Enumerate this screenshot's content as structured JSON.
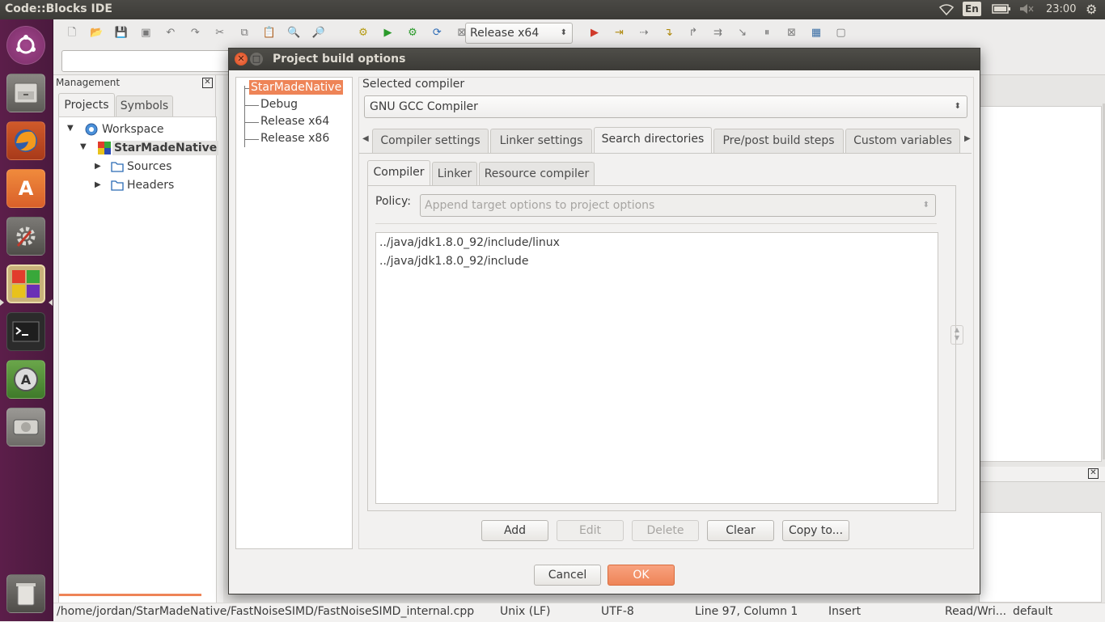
{
  "top_panel": {
    "window_title": "Code::Blocks IDE",
    "keyboard": "En",
    "time": "23:00"
  },
  "launcher": {
    "items": [
      "ubuntu-logo-icon",
      "file-manager-icon",
      "firefox-icon",
      "software-center-icon",
      "system-settings-icon",
      "codeblocks-icon",
      "terminal-icon",
      "software-updater-icon",
      "disk-icon"
    ],
    "trash": "trash-icon"
  },
  "toolbar": {
    "build_target": "Release x64"
  },
  "management": {
    "title": "Management",
    "tabs": [
      "Projects",
      "Symbols"
    ],
    "tree": {
      "workspace": "Workspace",
      "project": "StarMadeNative",
      "folders": [
        "Sources",
        "Headers"
      ]
    }
  },
  "dialog": {
    "title": "Project build options",
    "targets": [
      "StarMadeNative",
      "Debug",
      "Release x64",
      "Release x86"
    ],
    "selected_compiler_label": "Selected compiler",
    "compiler": "GNU GCC Compiler",
    "main_tabs": [
      "Compiler settings",
      "Linker settings",
      "Search directories",
      "Pre/post build steps",
      "Custom variables"
    ],
    "sub_tabs": [
      "Compiler",
      "Linker",
      "Resource compiler"
    ],
    "policy_label": "Policy:",
    "policy_value": "Append target options to project options",
    "directories": [
      "../java/jdk1.8.0_92/include/linux",
      "../java/jdk1.8.0_92/include"
    ],
    "buttons": {
      "add": "Add",
      "edit": "Edit",
      "delete": "Delete",
      "clear": "Clear",
      "copy": "Copy to..."
    },
    "footer": {
      "cancel": "Cancel",
      "ok": "OK"
    }
  },
  "statusbar": {
    "path": "/home/jordan/StarMadeNative/FastNoiseSIMD/FastNoiseSIMD_internal.cpp",
    "eol": "Unix (LF)",
    "encoding": "UTF-8",
    "position": "Line 97, Column 1",
    "mode": "Insert",
    "access": "Read/Wri...",
    "lang": "default"
  },
  "colors": {
    "accent": "#ee8457",
    "launcher": "#5c1e4a",
    "panel": "#3c3b37"
  }
}
